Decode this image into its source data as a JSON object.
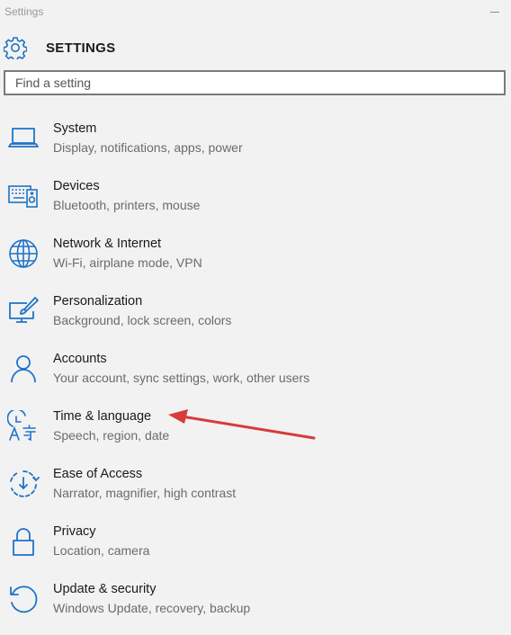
{
  "window": {
    "title": "Settings"
  },
  "header": {
    "title": "SETTINGS",
    "icon": "gear-icon"
  },
  "search": {
    "placeholder": "Find a setting"
  },
  "colors": {
    "accent": "#1e73c8",
    "annotation_arrow": "#d93a3a"
  },
  "items": [
    {
      "label": "System",
      "description": "Display, notifications, apps, power",
      "icon": "laptop-icon"
    },
    {
      "label": "Devices",
      "description": "Bluetooth, printers, mouse",
      "icon": "devices-icon"
    },
    {
      "label": "Network & Internet",
      "description": "Wi-Fi, airplane mode, VPN",
      "icon": "globe-icon"
    },
    {
      "label": "Personalization",
      "description": "Background, lock screen, colors",
      "icon": "personalization-icon"
    },
    {
      "label": "Accounts",
      "description": "Your account, sync settings, work, other users",
      "icon": "person-icon"
    },
    {
      "label": "Time & language",
      "description": "Speech, region, date",
      "icon": "time-language-icon"
    },
    {
      "label": "Ease of Access",
      "description": "Narrator, magnifier, high contrast",
      "icon": "ease-of-access-icon"
    },
    {
      "label": "Privacy",
      "description": "Location, camera",
      "icon": "lock-icon"
    },
    {
      "label": "Update & security",
      "description": "Windows Update, recovery, backup",
      "icon": "update-icon"
    }
  ]
}
